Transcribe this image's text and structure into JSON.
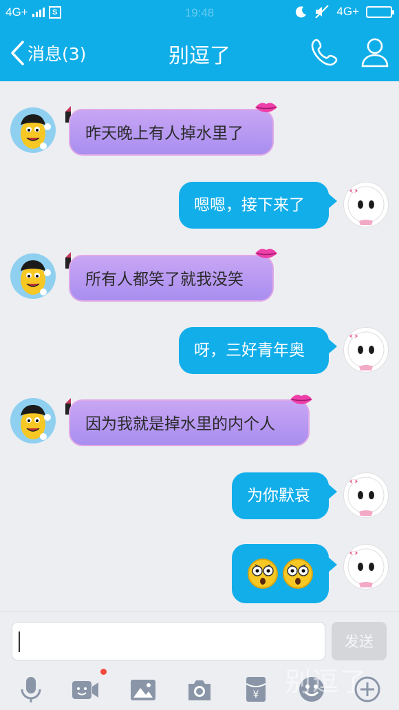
{
  "status_bar": {
    "network_left": "4G+",
    "network_right": "4G+",
    "time": "19:48",
    "icons": [
      "signal-icon",
      "screenshot-icon",
      "moon-icon",
      "mute-icon",
      "battery-icon"
    ]
  },
  "header": {
    "back_label": "消息(3)",
    "title": "别逗了",
    "actions": [
      "phone-icon",
      "profile-icon"
    ]
  },
  "messages": [
    {
      "sender": "friend",
      "text": "昨天晚上有人掉水里了"
    },
    {
      "sender": "me",
      "text": "嗯嗯，接下来了"
    },
    {
      "sender": "friend",
      "text": "所有人都笑了就我没笑"
    },
    {
      "sender": "me",
      "text": "呀，三好青年奥"
    },
    {
      "sender": "friend",
      "text": "因为我就是掉水里的内个人"
    },
    {
      "sender": "me",
      "text": "为你默哀"
    },
    {
      "sender": "me",
      "emoji": [
        "shocked-face-icon",
        "shocked-face-icon"
      ]
    }
  ],
  "input": {
    "value": "",
    "send_label": "发送"
  },
  "toolbar": {
    "items": [
      "microphone-icon",
      "video-icon",
      "image-icon",
      "camera-icon",
      "red-envelope-icon",
      "emoji-icon",
      "plus-icon"
    ],
    "video_badge": true
  },
  "watermark": "别逗了",
  "colors": {
    "accent": "#10aee8",
    "my_bubble": "#12aeea",
    "friend_bubble": "#b49af2",
    "background": "#eceef2"
  }
}
